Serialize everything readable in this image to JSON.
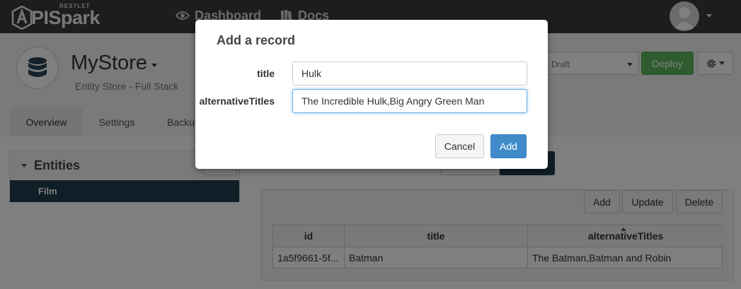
{
  "navbar": {
    "logo_small": "RESTLET",
    "logo_name": "PISpark",
    "links": [
      {
        "label": "Dashboard",
        "icon": "eye-icon"
      },
      {
        "label": "Docs",
        "icon": "books-icon"
      }
    ]
  },
  "store": {
    "name": "MyStore",
    "subtitle": "Entity Store - Full Stack",
    "version_select": "Draft",
    "deploy_label": "Deploy"
  },
  "tabs": [
    {
      "label": "Overview",
      "active": true
    },
    {
      "label": "Settings",
      "active": false
    },
    {
      "label": "Backu",
      "active": false
    }
  ],
  "entities": {
    "title": "Entities",
    "items": [
      "Film"
    ]
  },
  "records": {
    "buttons": [
      "Add",
      "Update",
      "Delete"
    ],
    "columns": [
      "id",
      "title",
      "alternativeTitles"
    ],
    "rows": [
      [
        "1a5f9661-5f...",
        "Batman",
        "The Batman,Batman and Robin"
      ]
    ]
  },
  "modal": {
    "title": "Add a record",
    "fields": [
      {
        "label": "title",
        "value": "Hulk"
      },
      {
        "label": "alternativeTitles",
        "value": "The Incredible Hulk,Big Angry Green Man"
      }
    ],
    "cancel_label": "Cancel",
    "add_label": "Add"
  },
  "colors": {
    "navbar": "#3a3a3a",
    "deploy": "#5cb85c",
    "primary": "#428bca",
    "selected_row": "#1f3d4f"
  }
}
